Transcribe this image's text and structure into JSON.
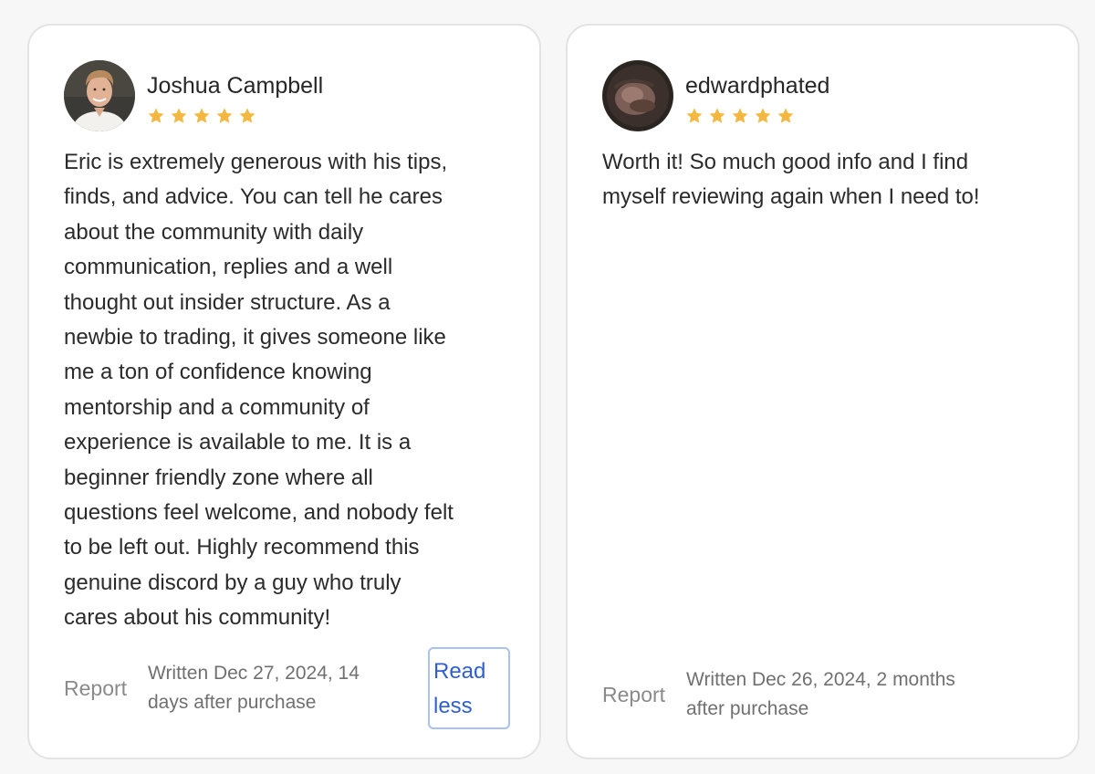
{
  "colors": {
    "star": "#f4b840",
    "link": "#2f5fd0",
    "link_border": "#a9c2f3",
    "card_border": "#e3e3e3"
  },
  "reviews": [
    {
      "name": "Joshua Campbell",
      "rating": 5,
      "body": "Eric is extremely generous with his tips,\nfinds, and advice. You can tell he cares\nabout the community with daily\ncommunication, replies and a well\nthought out insider structure. As a\nnewbie to trading, it gives someone like\nme a ton of confidence knowing\nmentorship and a community of\nexperience is available to me. It is a\nbeginner friendly zone where all\nquestions feel welcome, and nobody felt\nto be left out. Highly recommend this\ngenuine discord by a guy who truly\ncares about his community!",
      "report_label": "Report",
      "written": "Written Dec 27, 2024, 14\ndays after purchase",
      "toggle_label": "Read\nless",
      "avatar_icon": "user-photo-avatar-icon"
    },
    {
      "name": "edwardphated",
      "rating": 5,
      "body": "Worth it! So much good info and I find\nmyself reviewing again when I need to!",
      "report_label": "Report",
      "written": "Written Dec 26, 2024, 2 months\nafter purchase",
      "avatar_icon": "user-photo-avatar-icon"
    }
  ]
}
